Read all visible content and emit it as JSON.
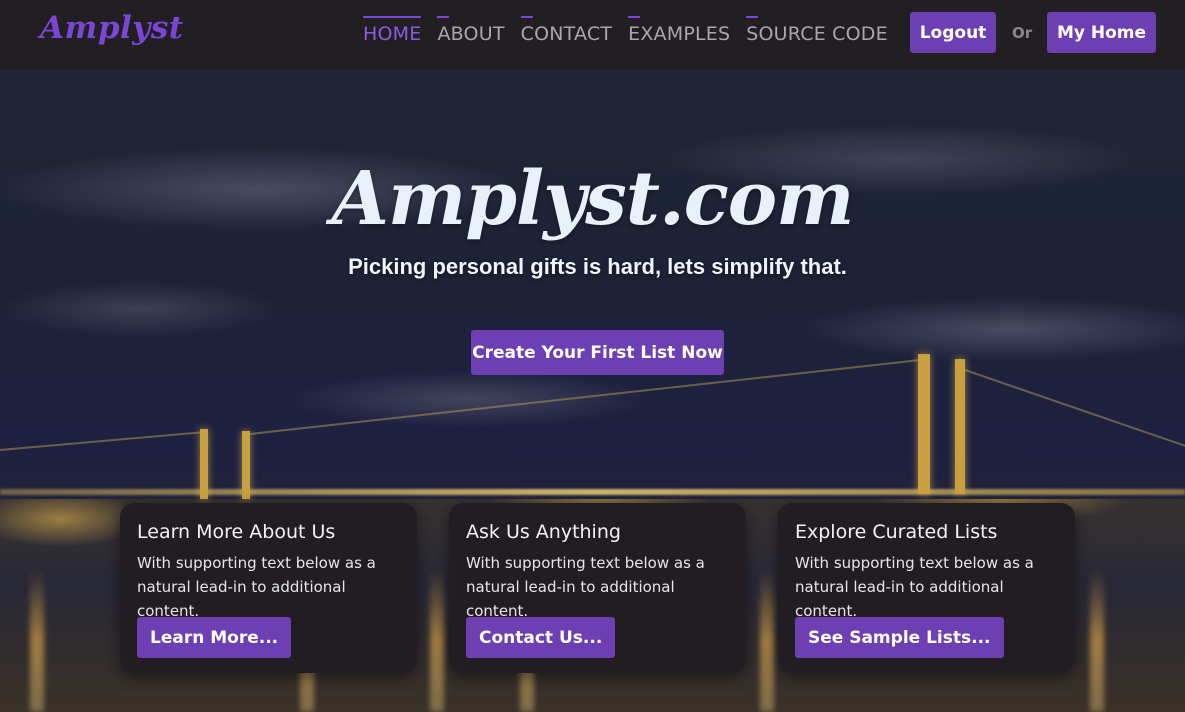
{
  "navbar": {
    "brand": "Amplyst",
    "links": [
      {
        "label": "HOME",
        "active": true
      },
      {
        "label": "ABOUT",
        "active": false
      },
      {
        "label": "CONTACT",
        "active": false
      },
      {
        "label": "EXAMPLES",
        "active": false
      },
      {
        "label": "SOURCE CODE",
        "active": false
      }
    ],
    "logout_label": "Logout",
    "or_text": "Or",
    "my_home_label": "My Home"
  },
  "hero": {
    "title": "Amplyst.com",
    "subtitle": "Picking personal gifts is hard, lets simplify that.",
    "cta_label": "Create Your First List Now"
  },
  "cards": [
    {
      "title": "Learn More About Us",
      "text": "With supporting text below as a natural lead-in to additional content.",
      "button": "Learn More..."
    },
    {
      "title": "Ask Us Anything",
      "text": "With supporting text below as a natural lead-in to additional content.",
      "button": "Contact Us..."
    },
    {
      "title": "Explore Curated Lists",
      "text": "With supporting text below as a natural lead-in to additional content.",
      "button": "See Sample Lists..."
    }
  ],
  "colors": {
    "accent": "#6d3fb3",
    "brand": "#7a46d8",
    "navbar_bg": "#221f23",
    "card_bg": "#211d22"
  }
}
